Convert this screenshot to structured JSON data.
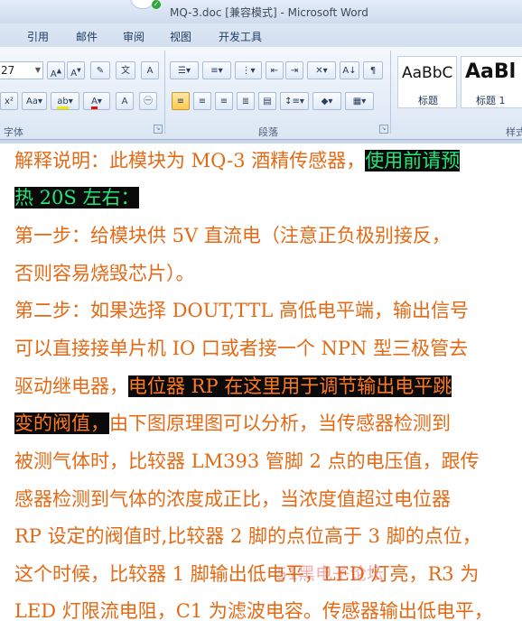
{
  "window": {
    "title": "MQ-3.doc [兼容模式] - Microsoft Word"
  },
  "ribbon": {
    "tabs": [
      "引用",
      "邮件",
      "审阅",
      "视图",
      "开发工具"
    ],
    "font": {
      "size": "27",
      "group_label": "字体"
    },
    "paragraph": {
      "group_label": "段落"
    },
    "styles": {
      "items": [
        {
          "sample": "AaBbC",
          "label": "标题"
        },
        {
          "sample": "AaBl",
          "label": "标题 1"
        }
      ],
      "group_label": "样式"
    }
  },
  "document": {
    "lines": [
      [
        {
          "text": "解释说明：此模块为 MQ-3 酒精传感器，"
        },
        {
          "text": "使用前请预",
          "hl": "green"
        }
      ],
      [
        {
          "text": "热 20S 左右：",
          "hl": "green"
        }
      ],
      [
        {
          "text": "第一步：给模块供 5V 直流电（注意正负极别接反，"
        }
      ],
      [
        {
          "text": "否则容易烧毁芯片）。"
        }
      ],
      [
        {
          "text": "第二步：如果选择 DOUT,TTL 高低电平端，输出信号"
        }
      ],
      [
        {
          "text": "可以直接接单片机 IO 口或者接一个 NPN 型三极管去"
        }
      ],
      [
        {
          "text": "驱动继电器，"
        },
        {
          "text": "电位器 RP 在这里用于调节输出电平跳",
          "hl": "orange"
        }
      ],
      [
        {
          "text": "变的阀值，",
          "hl": "orange"
        },
        {
          "text": "由下图原理图可以分析，当传感器检测到"
        }
      ],
      [
        {
          "text": "被测气体时，比较器 LM393 管脚 2 点的电压值，跟传"
        }
      ],
      [
        {
          "text": "感器检测到气体的浓度成正比，当浓度值超过电位器"
        }
      ],
      [
        {
          "text": "RP 设定的阀值时,比较器 2 脚的点位高于 3 脚的点位，"
        }
      ],
      [
        {
          "text": "这个时候，比较器 1 脚输出低电平，LED 灯亮，R3 为"
        }
      ],
      [
        {
          "text": "LED 灯限流电阻，C1 为滤波电容。传感器输出低电平，"
        }
      ]
    ],
    "watermark": "51黑电子论坛"
  }
}
